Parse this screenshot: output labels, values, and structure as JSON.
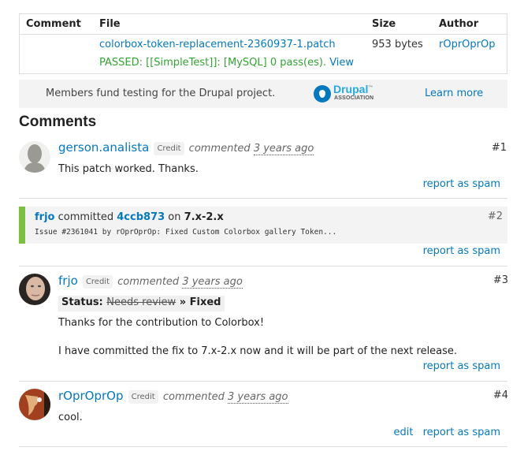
{
  "file_table": {
    "headers": [
      "Comment",
      "File",
      "Size",
      "Author"
    ],
    "rows": [
      {
        "comment": "",
        "file": "colorbox-token-replacement-2360937-1.patch",
        "size": "953 bytes",
        "author": "rOprOprOp",
        "test_result": "PASSED: [[SimpleTest]]: [MySQL] 0 pass(es).",
        "view_link": "View"
      }
    ]
  },
  "banner": {
    "text": "Members fund testing for the Drupal project.",
    "logo_word": "Drupal",
    "logo_tm": "™",
    "logo_sub": "ASSOCIATION",
    "learn_more": "Learn more"
  },
  "comments_title": "Comments",
  "colors": {
    "link": "#0678be",
    "passed": "#33a333",
    "commit_bar": "#7bc043"
  },
  "comments": [
    {
      "number": "#1",
      "author": "gerson.analista",
      "credit": "Credit",
      "commented": "commented",
      "ago": "3 years ago",
      "body": "This patch worked. Thanks.",
      "actions": [
        "report as spam"
      ],
      "avatar": "default-user-icon"
    },
    {
      "number": "#2",
      "author": "frjo",
      "committed": "committed",
      "hash": "4ccb873",
      "on": "on",
      "branch": "7.x-2.x",
      "message": "Issue #2361041 by rOprOprOp: Fixed Custom Colorbox gallery Token...",
      "actions": [
        "report as spam"
      ]
    },
    {
      "number": "#3",
      "author": "frjo",
      "credit": "Credit",
      "commented": "commented",
      "ago": "3 years ago",
      "status_label": "Status:",
      "status_old": "Needs review",
      "status_arrow": "»",
      "status_new": "Fixed",
      "body_lines": [
        "Thanks for the contribution to Colorbox!",
        "I have committed the fix to 7.x-2.x now and it will be part of the next release."
      ],
      "actions": [
        "report as spam"
      ],
      "avatar": "user-photo"
    },
    {
      "number": "#4",
      "author": "rOprOprOp",
      "credit": "Credit",
      "commented": "commented",
      "ago": "3 years ago",
      "body": "cool.",
      "actions": [
        "edit",
        "report as spam"
      ],
      "avatar": "user-photo"
    }
  ]
}
